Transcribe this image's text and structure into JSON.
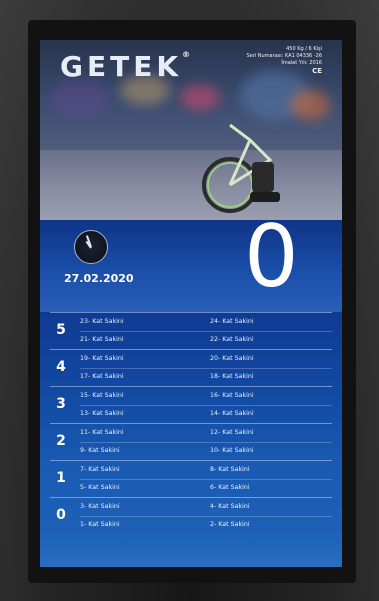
{
  "brand": {
    "logo_text": "GETEK",
    "logo_mark": "®"
  },
  "specs": {
    "capacity": "450 Kg / 6 Kişi",
    "serial": "Seri Numarası: KA1 04336 -26",
    "year": "İmalat Yılı: 2016",
    "mark": "CE"
  },
  "status": {
    "date": "27.02.2020",
    "current_floor": "0",
    "clock_icon": "analog-clock-icon"
  },
  "directory": {
    "floors": [
      {
        "floor": "5",
        "left": [
          "23- Kat Sakini",
          "21- Kat Sakini"
        ],
        "right": [
          "24- Kat Sakini",
          "22- Kat Sakini"
        ]
      },
      {
        "floor": "4",
        "left": [
          "19- Kat Sakini",
          "17- Kat Sakini"
        ],
        "right": [
          "20- Kat Sakini",
          "18- Kat Sakini"
        ]
      },
      {
        "floor": "3",
        "left": [
          "15- Kat Sakini",
          "13- Kat Sakini"
        ],
        "right": [
          "16- Kat Sakini",
          "14- Kat Sakini"
        ]
      },
      {
        "floor": "2",
        "left": [
          "11- Kat Sakini",
          "9- Kat Sakini"
        ],
        "right": [
          "12- Kat Sakini",
          "10- Kat Sakini"
        ]
      },
      {
        "floor": "1",
        "left": [
          "7- Kat Sakini",
          "5- Kat Sakini"
        ],
        "right": [
          "8- Kat Sakini",
          "6- Kat Sakini"
        ]
      },
      {
        "floor": "0",
        "left": [
          "3- Kat Sakini",
          "1- Kat Sakini"
        ],
        "right": [
          "4- Kat Sakini",
          "2- Kat Sakini"
        ]
      }
    ]
  },
  "colors": {
    "screen_blue": "#0f3c98",
    "text": "#ffffff"
  }
}
